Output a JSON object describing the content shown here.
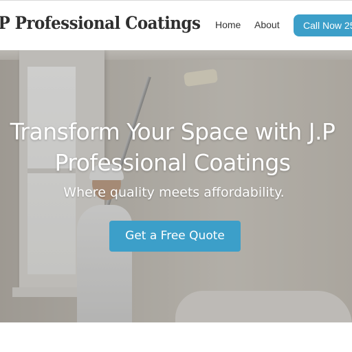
{
  "header": {
    "logo_text": ".P Professional Coatings",
    "nav": [
      {
        "label": "Home"
      },
      {
        "label": "About"
      }
    ],
    "call_button_label": "Call Now 25"
  },
  "hero": {
    "title": "Transform Your Space with J.P Professional Coatings",
    "subtitle": "Where quality meets affordability.",
    "cta_label": "Get a Free Quote"
  },
  "colors": {
    "accent": "#3c9fc9",
    "logo_text": "#2f2f2f",
    "nav_text": "#333333"
  }
}
